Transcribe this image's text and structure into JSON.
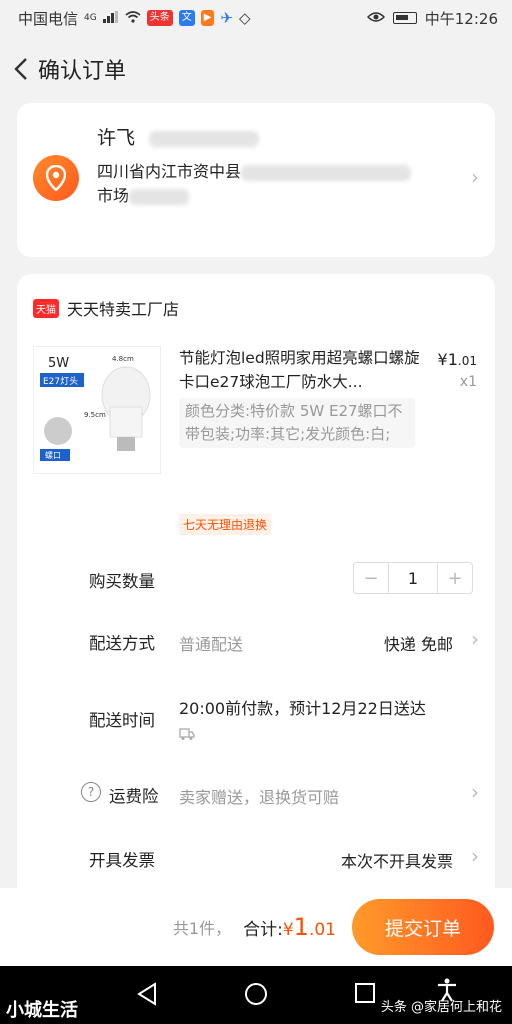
{
  "status_bar": {
    "carrier": "中国电信",
    "network": "4G",
    "apps": [
      "头条"
    ],
    "time": "中午12:26"
  },
  "header": {
    "title": "确认订单"
  },
  "address": {
    "name": "许飞",
    "line1": "四川省内江市资中县",
    "line2": "市场"
  },
  "shop": {
    "badge": "天猫",
    "name": "天天特卖工厂店"
  },
  "product": {
    "image_label_watts": "5W",
    "image_label_base": "E27灯头",
    "image_label_width": "4.8cm",
    "image_label_height": "9.5cm",
    "image_label_screw": "螺口",
    "title": "节能灯泡led照明家用超亮螺口螺旋卡口e27球泡工厂防水大...",
    "price_symbol": "¥",
    "price_int": "1",
    "price_dec": ".01",
    "quantity": "x1",
    "sku": "颜色分类:特价款 5W E27螺口不带包装;功率:其它;发光颜色:白;",
    "tag": "七天无理由退换"
  },
  "rows": {
    "qty_label": "购买数量",
    "qty_value": "1",
    "qty_minus": "−",
    "qty_plus": "+",
    "ship_label": "配送方式",
    "ship_value": "普通配送",
    "ship_right": "快递 免邮",
    "time_label": "配送时间",
    "time_value": "20:00前付款，预计12月22日送达",
    "ins_label": "运费险",
    "ins_value": "卖家赠送，退换货可赔",
    "invoice_label": "开具发票",
    "invoice_right": "本次不开具发票"
  },
  "bottom": {
    "count": "共1件，",
    "total_label": "合计:",
    "total_symbol": "¥",
    "total_int": "1",
    "total_dec": ".01",
    "submit": "提交订单"
  },
  "watermarks": {
    "left": "小城生活",
    "right": "头条 @家居何上和花"
  },
  "colors": {
    "accent": "#ff5000",
    "button_gradient_start": "#ff9a2a",
    "button_gradient_end": "#ff5a1f"
  }
}
